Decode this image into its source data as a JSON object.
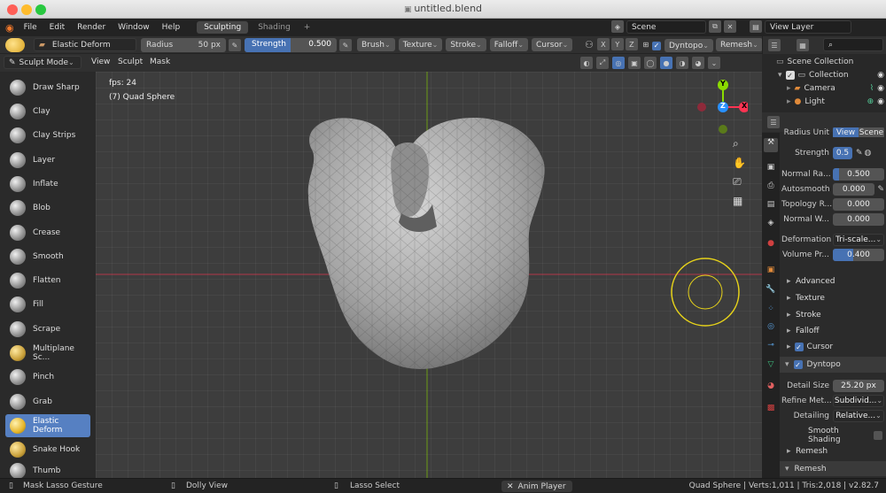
{
  "window": {
    "title": "untitled.blend"
  },
  "menubar": {
    "menus": [
      "File",
      "Edit",
      "Render",
      "Window",
      "Help"
    ],
    "tabs": [
      "Sculpting",
      "Shading"
    ],
    "add_tab": "+",
    "scene": "Scene",
    "view_layer": "View Layer"
  },
  "tool_header": {
    "brush_name": "Elastic Deform",
    "radius_label": "Radius",
    "radius_value": "50 px",
    "strength_label": "Strength",
    "strength_value": "0.500",
    "strength_fill": 0.5,
    "menus": [
      "Brush",
      "Texture",
      "Stroke",
      "Falloff",
      "Cursor"
    ],
    "axes": [
      "X",
      "Y",
      "Z"
    ],
    "dyntopo": "Dyntopo",
    "remesh": "Remesh"
  },
  "mode_header": {
    "mode": "Sculpt Mode",
    "menus": [
      "View",
      "Sculpt",
      "Mask"
    ]
  },
  "toolbar": {
    "tools": [
      "Draw Sharp",
      "Clay",
      "Clay Strips",
      "Layer",
      "Inflate",
      "Blob",
      "Crease",
      "Smooth",
      "Flatten",
      "Fill",
      "Scrape",
      "Multiplane Sc...",
      "Pinch",
      "Grab",
      "Elastic Deform",
      "Snake Hook",
      "Thumb"
    ],
    "active": "Elastic Deform"
  },
  "viewport": {
    "fps": "fps: 24",
    "object": "(7) Quad Sphere",
    "gizmo": {
      "x": "X",
      "y": "Y",
      "z": "Z"
    },
    "colors": {
      "x_axis": "#ff3352",
      "y_axis": "#8bdc00",
      "z_axis": "#2890ff",
      "cursor": "#e6d21a"
    }
  },
  "outliner": {
    "root": "Scene Collection",
    "items": [
      "Collection",
      "Camera",
      "Light"
    ]
  },
  "properties": {
    "radius_unit": {
      "label": "Radius Unit",
      "options": [
        "View",
        "Scene"
      ]
    },
    "strength": {
      "label": "Strength",
      "value": "0.5"
    },
    "rows": [
      {
        "label": "Normal Ra...",
        "value": "0.500"
      },
      {
        "label": "Autosmooth",
        "value": "0.000"
      },
      {
        "label": "Topology R...",
        "value": "0.000"
      },
      {
        "label": "Normal W...",
        "value": "0.000"
      }
    ],
    "deformation": {
      "label": "Deformation",
      "value": "Tri-scale..."
    },
    "volume": {
      "label": "Volume Pr...",
      "value": "0.400",
      "fill": 0.4
    },
    "subpanels": [
      "Advanced",
      "Texture",
      "Stroke",
      "Falloff",
      "Cursor"
    ],
    "dyntopo_panel": "Dyntopo",
    "detail_size": {
      "label": "Detail Size",
      "value": "25.20 px"
    },
    "refine": {
      "label": "Refine Met...",
      "value": "Subdivid..."
    },
    "detailing": {
      "label": "Detailing",
      "value": "Relative..."
    },
    "smooth_shading": "Smooth Shading",
    "remesh_sub": "Remesh",
    "remesh_panel": "Remesh"
  },
  "statusbar": {
    "mask_lasso": "Mask Lasso Gesture",
    "dolly": "Dolly View",
    "lasso_select": "Lasso Select",
    "anim_player": "Anim Player",
    "stats": "Quad Sphere | Verts:1,011 | Tris:2,018 | v2.82.7"
  }
}
